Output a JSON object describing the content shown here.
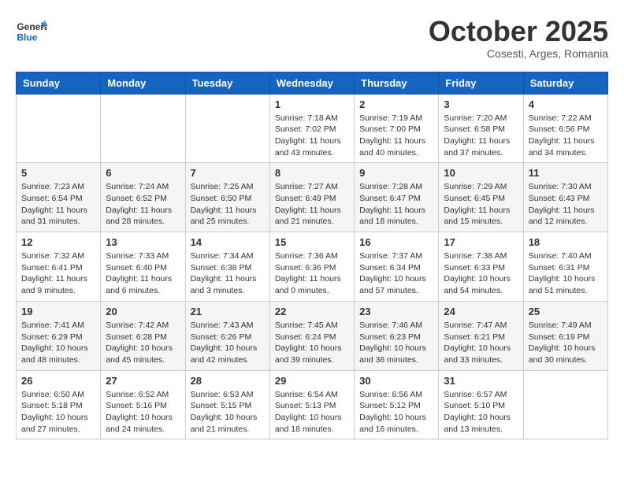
{
  "header": {
    "logo_line1": "General",
    "logo_line2": "Blue",
    "month": "October 2025",
    "location": "Cosesti, Arges, Romania"
  },
  "weekdays": [
    "Sunday",
    "Monday",
    "Tuesday",
    "Wednesday",
    "Thursday",
    "Friday",
    "Saturday"
  ],
  "weeks": [
    [
      {
        "day": "",
        "info": ""
      },
      {
        "day": "",
        "info": ""
      },
      {
        "day": "",
        "info": ""
      },
      {
        "day": "1",
        "info": "Sunrise: 7:18 AM\nSunset: 7:02 PM\nDaylight: 11 hours\nand 43 minutes."
      },
      {
        "day": "2",
        "info": "Sunrise: 7:19 AM\nSunset: 7:00 PM\nDaylight: 11 hours\nand 40 minutes."
      },
      {
        "day": "3",
        "info": "Sunrise: 7:20 AM\nSunset: 6:58 PM\nDaylight: 11 hours\nand 37 minutes."
      },
      {
        "day": "4",
        "info": "Sunrise: 7:22 AM\nSunset: 6:56 PM\nDaylight: 11 hours\nand 34 minutes."
      }
    ],
    [
      {
        "day": "5",
        "info": "Sunrise: 7:23 AM\nSunset: 6:54 PM\nDaylight: 11 hours\nand 31 minutes."
      },
      {
        "day": "6",
        "info": "Sunrise: 7:24 AM\nSunset: 6:52 PM\nDaylight: 11 hours\nand 28 minutes."
      },
      {
        "day": "7",
        "info": "Sunrise: 7:25 AM\nSunset: 6:50 PM\nDaylight: 11 hours\nand 25 minutes."
      },
      {
        "day": "8",
        "info": "Sunrise: 7:27 AM\nSunset: 6:49 PM\nDaylight: 11 hours\nand 21 minutes."
      },
      {
        "day": "9",
        "info": "Sunrise: 7:28 AM\nSunset: 6:47 PM\nDaylight: 11 hours\nand 18 minutes."
      },
      {
        "day": "10",
        "info": "Sunrise: 7:29 AM\nSunset: 6:45 PM\nDaylight: 11 hours\nand 15 minutes."
      },
      {
        "day": "11",
        "info": "Sunrise: 7:30 AM\nSunset: 6:43 PM\nDaylight: 11 hours\nand 12 minutes."
      }
    ],
    [
      {
        "day": "12",
        "info": "Sunrise: 7:32 AM\nSunset: 6:41 PM\nDaylight: 11 hours\nand 9 minutes."
      },
      {
        "day": "13",
        "info": "Sunrise: 7:33 AM\nSunset: 6:40 PM\nDaylight: 11 hours\nand 6 minutes."
      },
      {
        "day": "14",
        "info": "Sunrise: 7:34 AM\nSunset: 6:38 PM\nDaylight: 11 hours\nand 3 minutes."
      },
      {
        "day": "15",
        "info": "Sunrise: 7:36 AM\nSunset: 6:36 PM\nDaylight: 11 hours\nand 0 minutes."
      },
      {
        "day": "16",
        "info": "Sunrise: 7:37 AM\nSunset: 6:34 PM\nDaylight: 10 hours\nand 57 minutes."
      },
      {
        "day": "17",
        "info": "Sunrise: 7:38 AM\nSunset: 6:33 PM\nDaylight: 10 hours\nand 54 minutes."
      },
      {
        "day": "18",
        "info": "Sunrise: 7:40 AM\nSunset: 6:31 PM\nDaylight: 10 hours\nand 51 minutes."
      }
    ],
    [
      {
        "day": "19",
        "info": "Sunrise: 7:41 AM\nSunset: 6:29 PM\nDaylight: 10 hours\nand 48 minutes."
      },
      {
        "day": "20",
        "info": "Sunrise: 7:42 AM\nSunset: 6:28 PM\nDaylight: 10 hours\nand 45 minutes."
      },
      {
        "day": "21",
        "info": "Sunrise: 7:43 AM\nSunset: 6:26 PM\nDaylight: 10 hours\nand 42 minutes."
      },
      {
        "day": "22",
        "info": "Sunrise: 7:45 AM\nSunset: 6:24 PM\nDaylight: 10 hours\nand 39 minutes."
      },
      {
        "day": "23",
        "info": "Sunrise: 7:46 AM\nSunset: 6:23 PM\nDaylight: 10 hours\nand 36 minutes."
      },
      {
        "day": "24",
        "info": "Sunrise: 7:47 AM\nSunset: 6:21 PM\nDaylight: 10 hours\nand 33 minutes."
      },
      {
        "day": "25",
        "info": "Sunrise: 7:49 AM\nSunset: 6:19 PM\nDaylight: 10 hours\nand 30 minutes."
      }
    ],
    [
      {
        "day": "26",
        "info": "Sunrise: 6:50 AM\nSunset: 5:18 PM\nDaylight: 10 hours\nand 27 minutes."
      },
      {
        "day": "27",
        "info": "Sunrise: 6:52 AM\nSunset: 5:16 PM\nDaylight: 10 hours\nand 24 minutes."
      },
      {
        "day": "28",
        "info": "Sunrise: 6:53 AM\nSunset: 5:15 PM\nDaylight: 10 hours\nand 21 minutes."
      },
      {
        "day": "29",
        "info": "Sunrise: 6:54 AM\nSunset: 5:13 PM\nDaylight: 10 hours\nand 18 minutes."
      },
      {
        "day": "30",
        "info": "Sunrise: 6:56 AM\nSunset: 5:12 PM\nDaylight: 10 hours\nand 16 minutes."
      },
      {
        "day": "31",
        "info": "Sunrise: 6:57 AM\nSunset: 5:10 PM\nDaylight: 10 hours\nand 13 minutes."
      },
      {
        "day": "",
        "info": ""
      }
    ]
  ]
}
